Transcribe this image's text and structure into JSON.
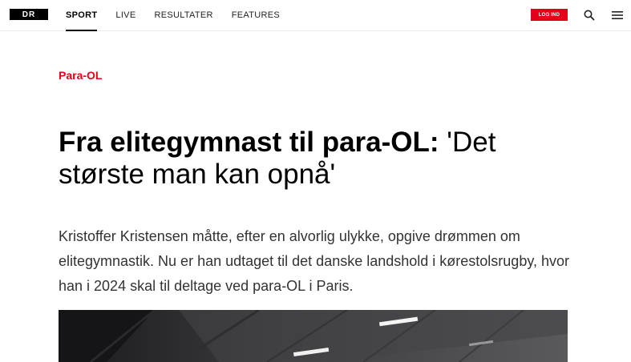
{
  "header": {
    "logo_text": "DR",
    "nav": [
      {
        "label": "SPORT",
        "active": true
      },
      {
        "label": "LIVE",
        "active": false
      },
      {
        "label": "RESULTATER",
        "active": false
      },
      {
        "label": "FEATURES",
        "active": false
      }
    ],
    "login_label": "LOG IND",
    "search_icon": "search-icon",
    "menu_icon": "hamburger-menu-icon"
  },
  "article": {
    "category": "Para-OL",
    "headline_bold": "Fra elitegymnast til para-OL:",
    "headline_rest": " 'Det største man kan opnå'",
    "lead": "Kristoffer Kristensen måtte, efter en alvorlig ulykke, opgive drømmen om elitegymnastik. Nu er han udtaget til det danske landshold i kørestolsrugby, hvor han i 2024 skal til deltage ved para-OL i Paris."
  },
  "colors": {
    "accent": "#e4001b",
    "text": "#000000",
    "lead_text": "#333333"
  }
}
